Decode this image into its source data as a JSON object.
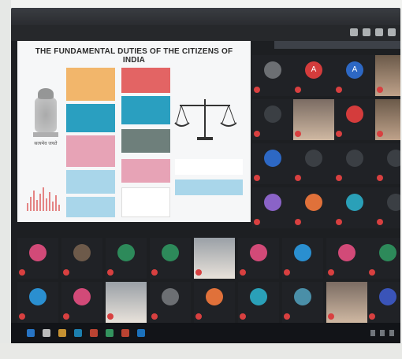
{
  "window": {
    "tab_title": "",
    "meeting_title": ""
  },
  "slide": {
    "title": "THE FUNDAMENTAL DUTIES OF THE CITIZENS OF INDIA",
    "emblem_caption": "सत्यमेव जयते"
  },
  "participants_row1": [
    {
      "initial": "",
      "color": "#6c6f73",
      "name": ""
    },
    {
      "initial": "A",
      "color": "#d43c3c",
      "name": ""
    },
    {
      "initial": "A",
      "color": "#2d68c4",
      "name": ""
    },
    {
      "initial": "",
      "color": "#3b3f44",
      "name": ""
    }
  ],
  "colors": {
    "slide_bg": "#f6f7f8",
    "box_orange": "#f2b66b",
    "box_red": "#e36464",
    "box_teal": "#2a9fc0",
    "box_pink": "#e7a3b6",
    "box_gray": "#6e7f7b",
    "box_lightblue": "#a9d6ea"
  }
}
